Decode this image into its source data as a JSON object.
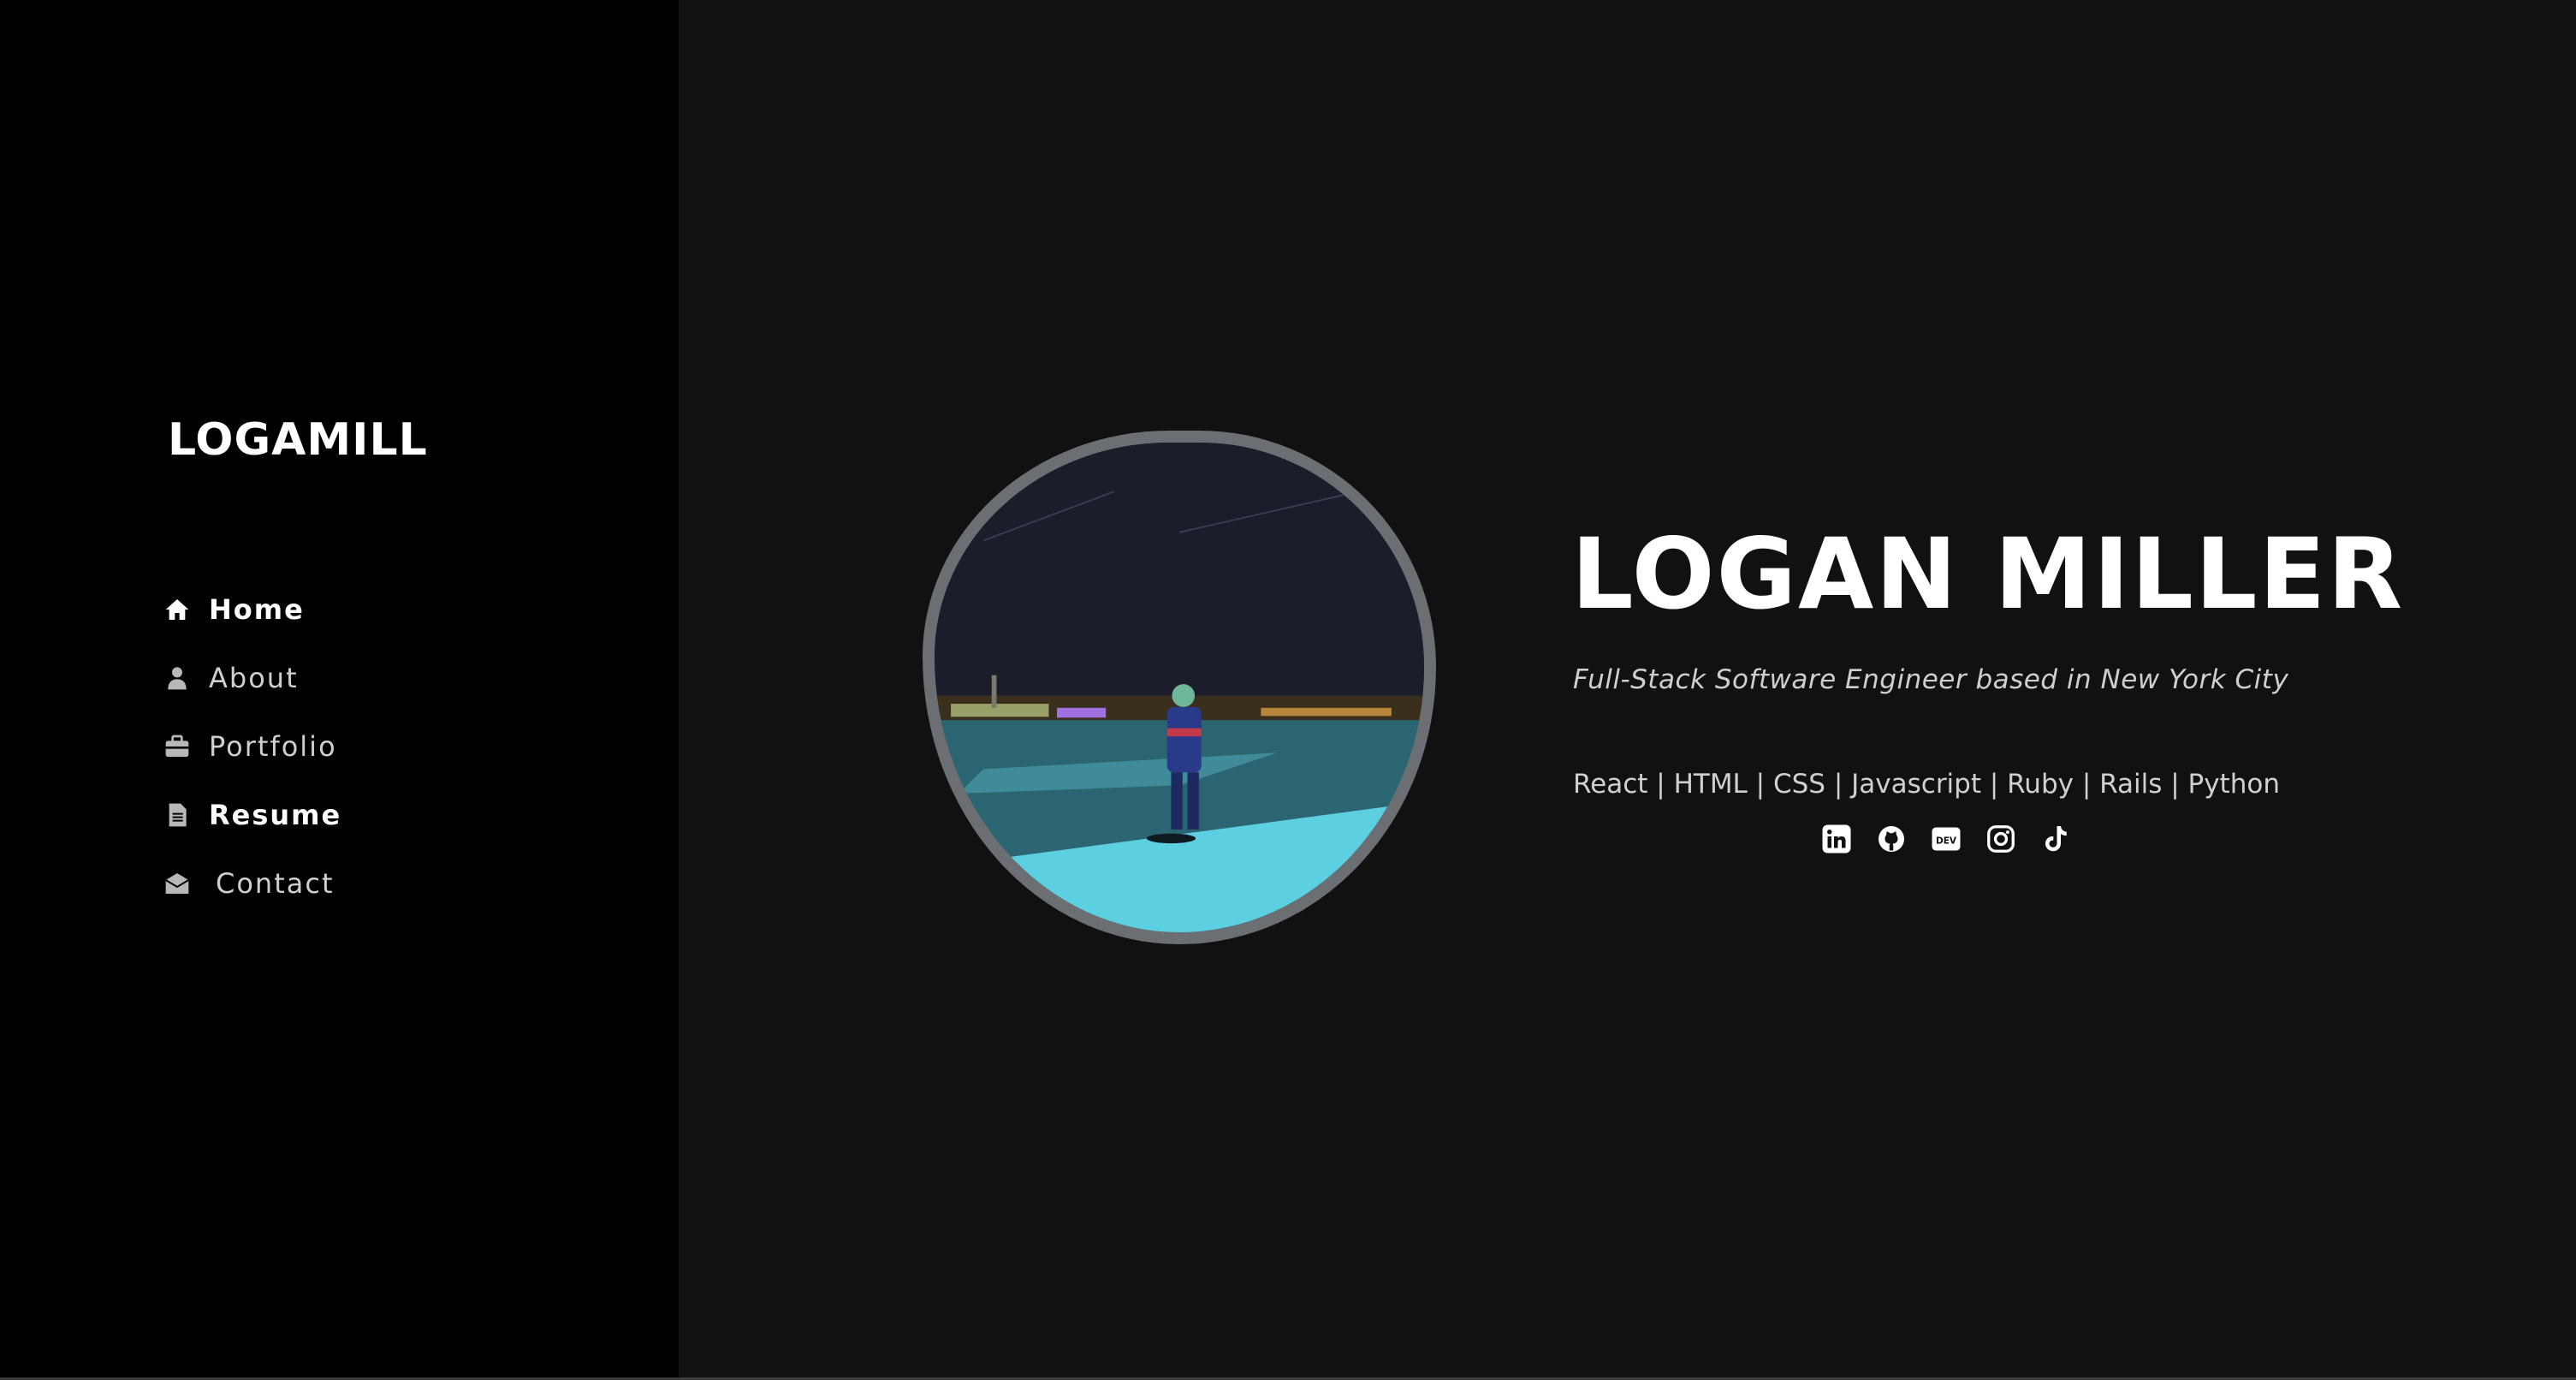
{
  "sidebar": {
    "logo": "LOGAMILL",
    "items": [
      {
        "label": "Home",
        "icon": "home-icon"
      },
      {
        "label": "About",
        "icon": "user-icon"
      },
      {
        "label": "Portfolio",
        "icon": "briefcase-icon"
      },
      {
        "label": "Resume",
        "icon": "document-icon"
      },
      {
        "label": "Contact",
        "icon": "envelope-icon"
      }
    ]
  },
  "hero": {
    "name": "LOGAN MILLER",
    "tagline": "Full-Stack Software Engineer based in New York City",
    "skills": "React | HTML | CSS | Javascript | Ruby | Rails | Python",
    "portrait_icon": "profile-photo",
    "socials": [
      {
        "icon": "linkedin-icon"
      },
      {
        "icon": "github-icon"
      },
      {
        "icon": "dev-icon"
      },
      {
        "icon": "instagram-icon"
      },
      {
        "icon": "tiktok-icon"
      }
    ]
  },
  "colors": {
    "sidebar_bg": "#000000",
    "main_bg": "#111112",
    "text_primary": "#ffffff",
    "text_secondary": "#cfcfcf",
    "portrait_border": "#6b6e72"
  }
}
